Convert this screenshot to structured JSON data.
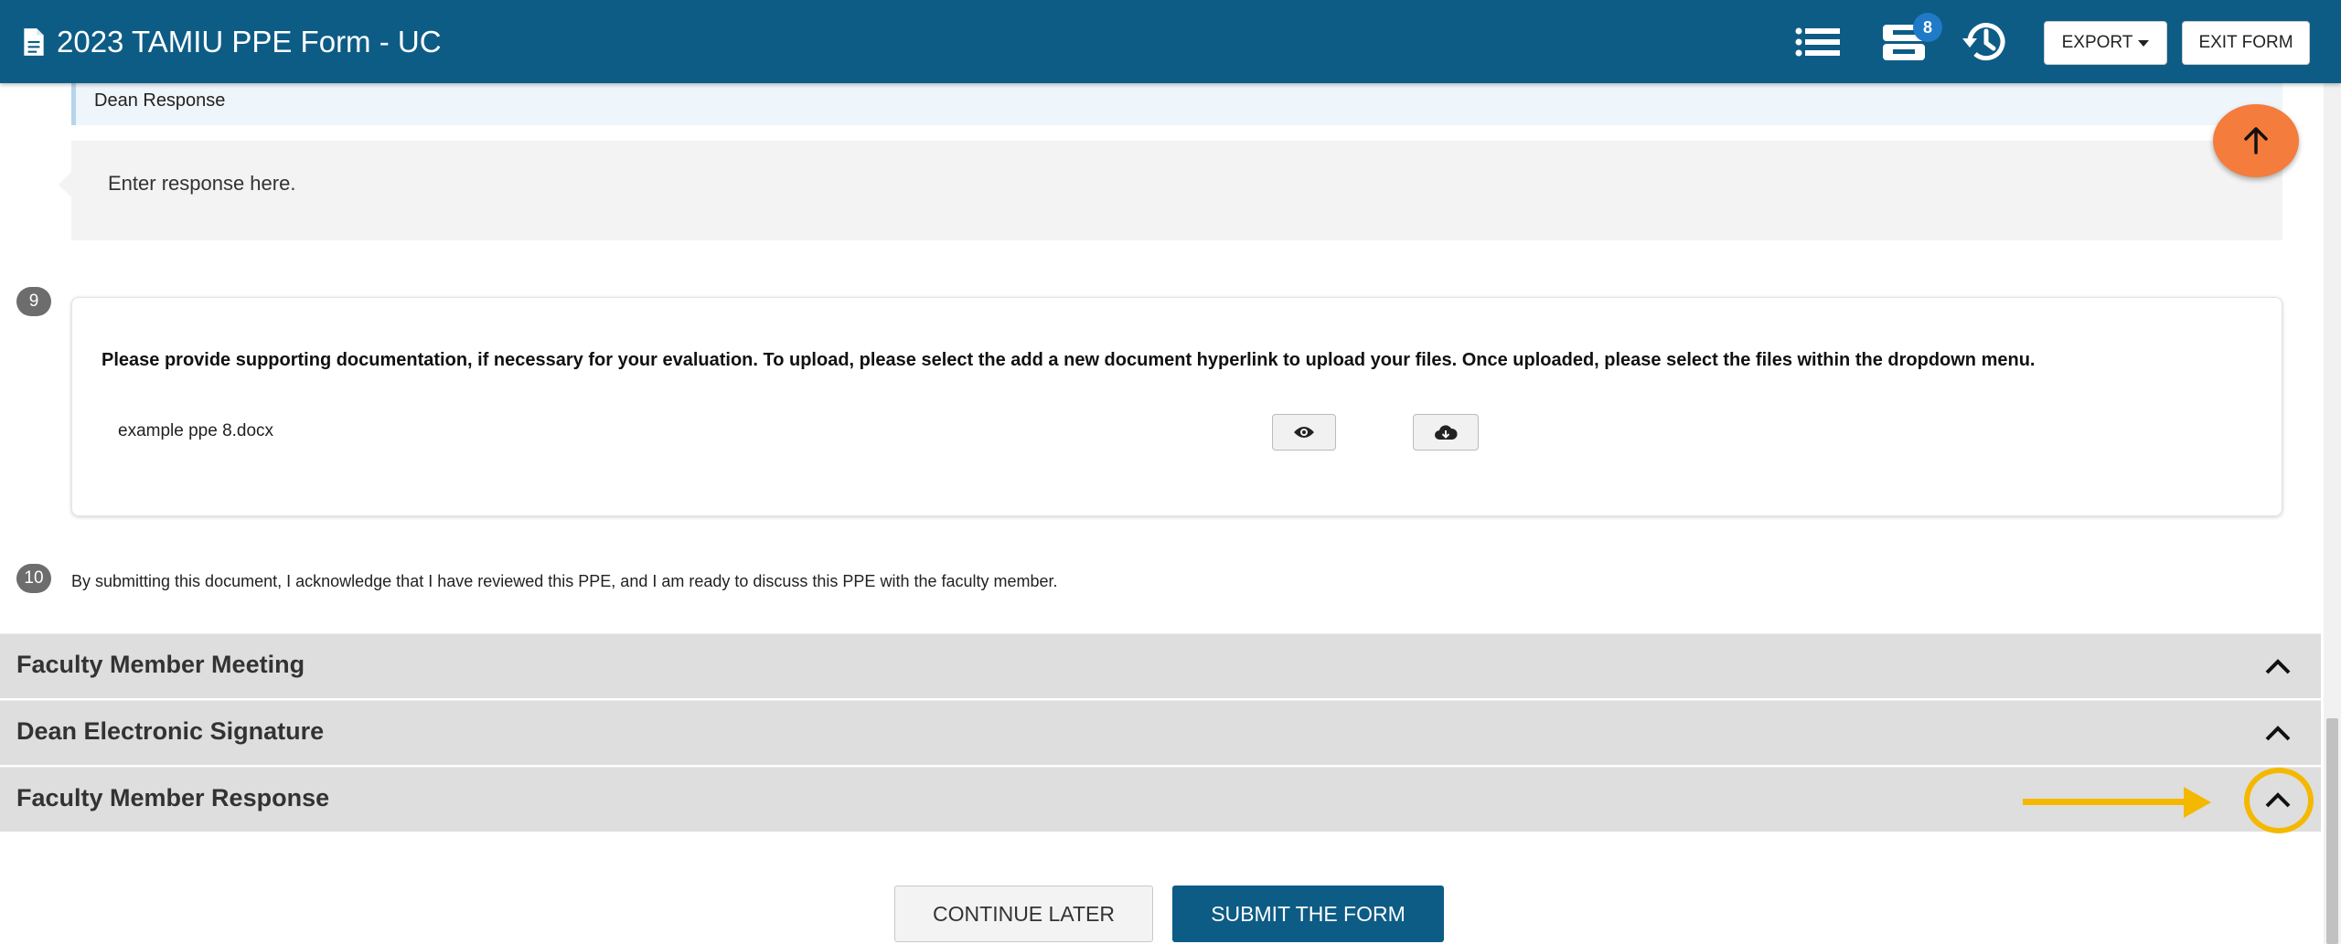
{
  "header": {
    "title": "2023 TAMIU PPE Form - UC",
    "icons": [
      "document-icon",
      "list-icon",
      "inbox-icon",
      "history-icon"
    ],
    "notification_count": "8",
    "export_label": "EXPORT",
    "exit_label": "EXIT FORM"
  },
  "dean_response": {
    "label": "Dean Response",
    "placeholder": "Enter response here."
  },
  "question9": {
    "number": "9",
    "text": "Please provide supporting documentation, if necessary for your evaluation. To upload, please select the add a new document hyperlink to upload your files. Once uploaded, please select the files within the dropdown menu.",
    "file_name": "example ppe 8.docx"
  },
  "question10": {
    "number": "10",
    "text": "By submitting this document, I acknowledge that I have reviewed this PPE, and I am ready to discuss this PPE with the faculty member."
  },
  "sections": [
    {
      "label": "Faculty Member Meeting"
    },
    {
      "label": "Dean Electronic Signature"
    },
    {
      "label": "Faculty Member Response"
    }
  ],
  "footer": {
    "continue_label": "CONTINUE LATER",
    "submit_label": "SUBMIT THE FORM"
  },
  "colors": {
    "header_bg": "#0d5c86",
    "fab": "#f47c3c",
    "highlight": "#f5b800"
  }
}
